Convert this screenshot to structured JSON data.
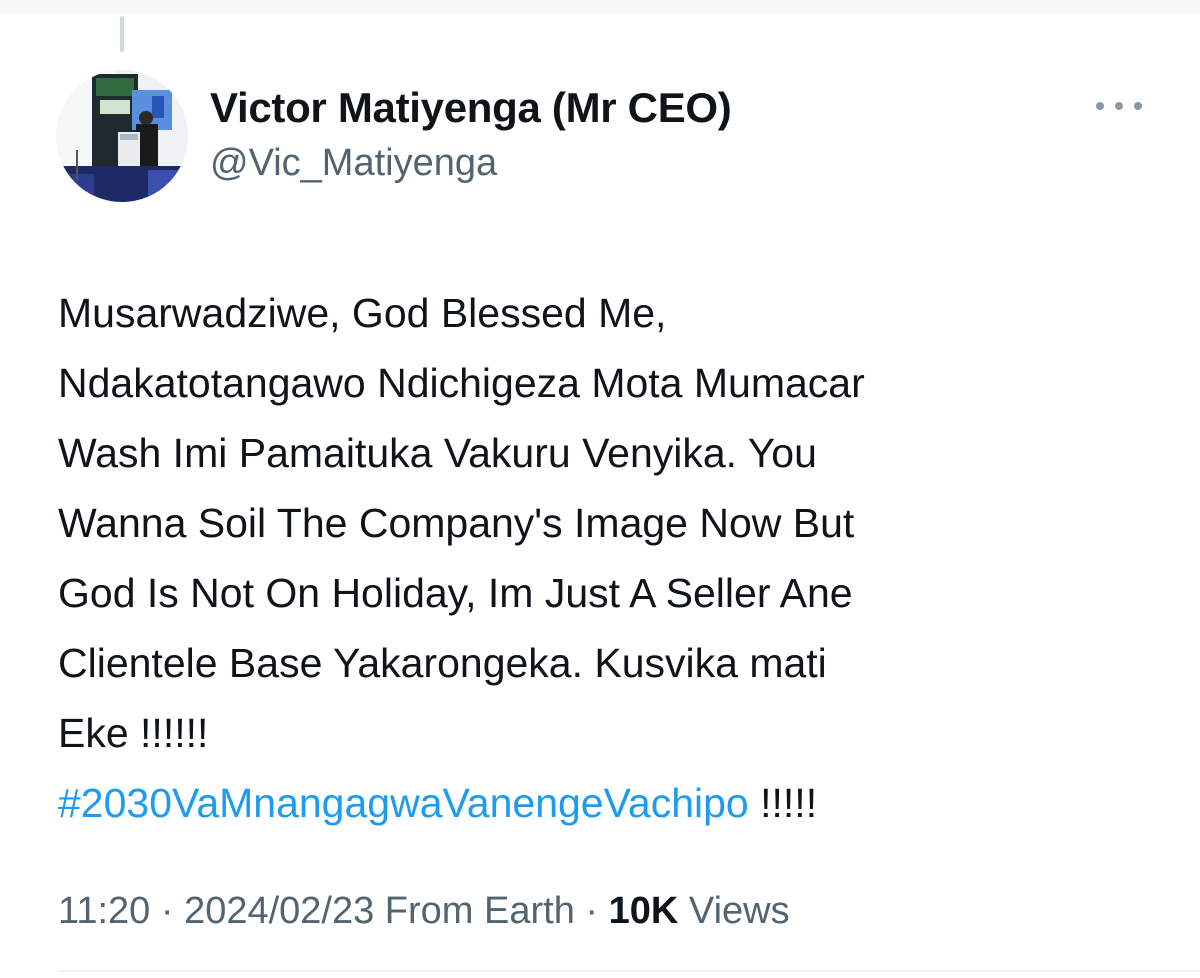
{
  "author": {
    "display_name": "Victor Matiyenga (Mr CEO)",
    "handle": "@Vic_Matiyenga"
  },
  "tweet": {
    "lines": [
      "Musarwadziwe, God Blessed Me,",
      "Ndakatotangawo Ndichigeza Mota Mumacar",
      "Wash Imi Pamaituka Vakuru Venyika. You",
      "Wanna Soil The Company's Image Now But",
      "God Is Not On Holiday, Im Just A Seller Ane",
      "Clientele Base Yakarongeka. Kusvika mati",
      "Eke !!!!!!"
    ],
    "hashtag": "#2030VaMnangagwaVanengeVachipo",
    "hashtag_suffix": " !!!!!"
  },
  "meta": {
    "time": "11:20",
    "separator": " · ",
    "date": "2024/02/23",
    "source": " From Earth",
    "views_count": "10K",
    "views_label": " Views"
  },
  "icons": {
    "more": "more-horizontal-icon"
  },
  "colors": {
    "text": "#0f1419",
    "secondary": "#536471",
    "link": "#1d9bf0"
  }
}
